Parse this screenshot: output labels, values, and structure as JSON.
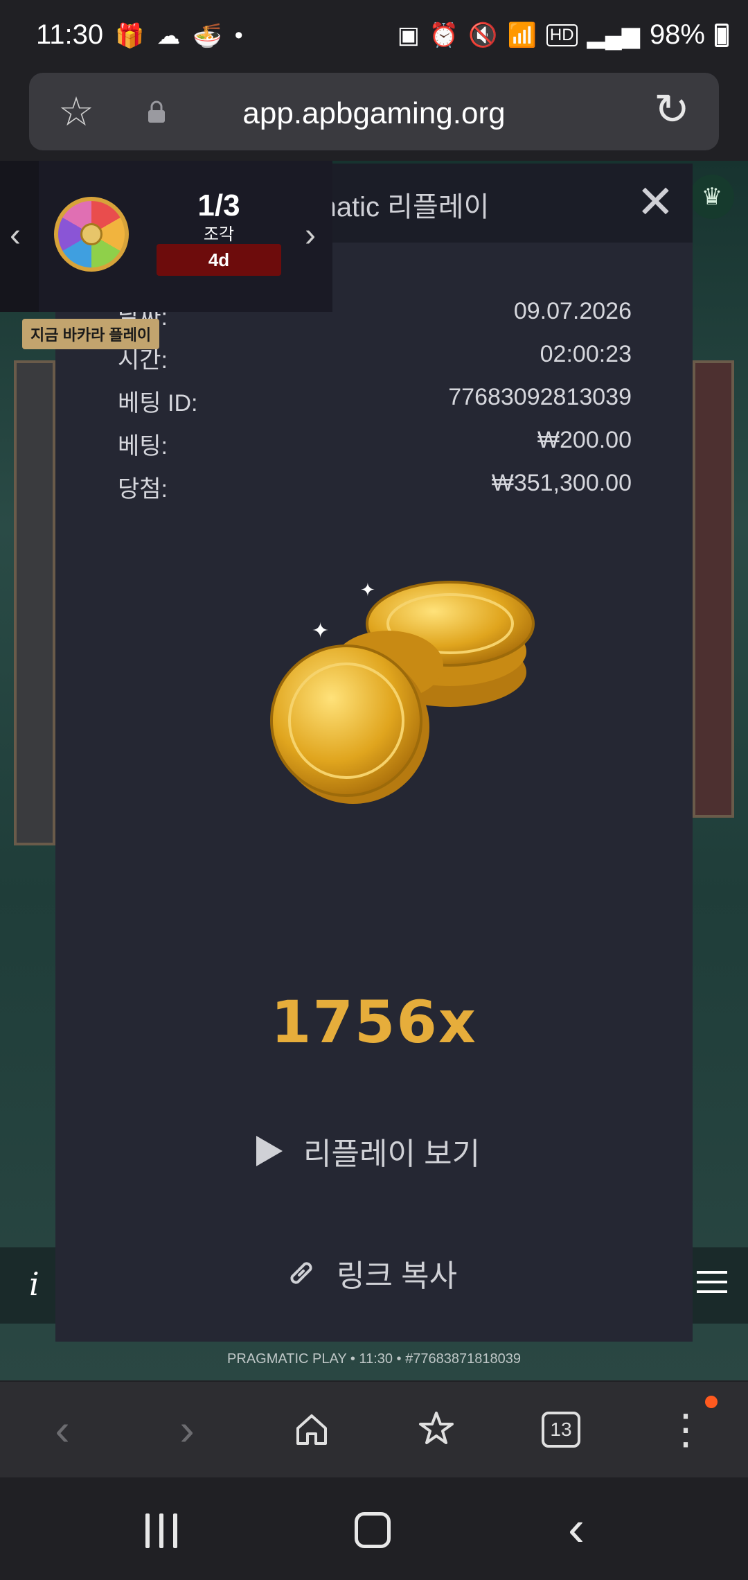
{
  "status_bar": {
    "time": "11:30",
    "battery_percent": "98%",
    "left_icons": [
      "gift-icon",
      "cloud-icon",
      "bowl-icon",
      "dot-icon"
    ],
    "right_icons": [
      "battery-saver-icon",
      "alarm-icon",
      "mute-icon",
      "wifi-icon",
      "hd-icon",
      "signal-icon"
    ]
  },
  "browser": {
    "url": "app.apbgaming.org",
    "tab_count": "13"
  },
  "promo": {
    "count": "1/3",
    "unit": "조각",
    "days_left": "4d",
    "tag": "지금 바카라 플레이"
  },
  "modal": {
    "title": "Pragmatic 리플레이",
    "rows": [
      {
        "label": "날짜:",
        "value": "09.07.2026"
      },
      {
        "label": "시간:",
        "value": "02:00:23"
      },
      {
        "label": "베팅 ID:",
        "value": "77683092813039"
      },
      {
        "label": "베팅:",
        "value": "₩200.00"
      },
      {
        "label": "당첨:",
        "value": "₩351,300.00"
      }
    ],
    "multiplier": "1756x",
    "replay_label": "리플레이 보기",
    "copy_label": "링크 복사"
  },
  "game": {
    "footer_caption": "PRAGMATIC PLAY • 11:30 • #77683871818039"
  },
  "colors": {
    "accent_gold": "#e6ad3b",
    "modal_bg": "#252733",
    "notif": "#ff5a1f"
  }
}
